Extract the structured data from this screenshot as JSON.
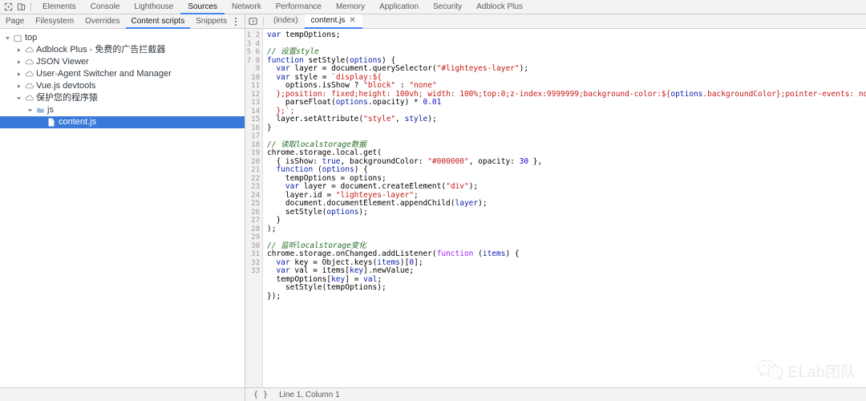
{
  "toolbar": {
    "icons": [
      {
        "name": "inspect-element-icon",
        "label": "Inspect element"
      },
      {
        "name": "device-toolbar-icon",
        "label": "Toggle device toolbar"
      }
    ],
    "tabs": [
      {
        "id": "elements",
        "label": "Elements",
        "active": false
      },
      {
        "id": "console",
        "label": "Console",
        "active": false
      },
      {
        "id": "lighthouse",
        "label": "Lighthouse",
        "active": false
      },
      {
        "id": "sources",
        "label": "Sources",
        "active": true
      },
      {
        "id": "network",
        "label": "Network",
        "active": false
      },
      {
        "id": "performance",
        "label": "Performance",
        "active": false
      },
      {
        "id": "memory",
        "label": "Memory",
        "active": false
      },
      {
        "id": "application",
        "label": "Application",
        "active": false
      },
      {
        "id": "security",
        "label": "Security",
        "active": false
      },
      {
        "id": "adblock",
        "label": "Adblock Plus",
        "active": false
      }
    ],
    "active_accent": "#4285f4"
  },
  "navigator": {
    "tabs": [
      {
        "id": "page",
        "label": "Page",
        "active": false
      },
      {
        "id": "filesystem",
        "label": "Filesystem",
        "active": false
      },
      {
        "id": "overrides",
        "label": "Overrides",
        "active": false
      },
      {
        "id": "content-scripts",
        "label": "Content scripts",
        "active": true
      },
      {
        "id": "snippets",
        "label": "Snippets",
        "active": false
      }
    ],
    "more_label": "More options",
    "tree": [
      {
        "label": "top",
        "indent": 0,
        "icon": "frame-icon",
        "twisty": "open",
        "selected": false
      },
      {
        "label": "Adblock Plus - 免费的广告拦截器",
        "indent": 1,
        "icon": "cloud-icon",
        "twisty": "closed",
        "selected": false
      },
      {
        "label": "JSON Viewer",
        "indent": 1,
        "icon": "cloud-icon",
        "twisty": "closed",
        "selected": false
      },
      {
        "label": "User-Agent Switcher and Manager",
        "indent": 1,
        "icon": "cloud-icon",
        "twisty": "closed",
        "selected": false
      },
      {
        "label": "Vue.js devtools",
        "indent": 1,
        "icon": "cloud-icon",
        "twisty": "closed",
        "selected": false
      },
      {
        "label": "保护您的程序猿",
        "indent": 1,
        "icon": "cloud-icon",
        "twisty": "open",
        "selected": false
      },
      {
        "label": "js",
        "indent": 2,
        "icon": "folder-icon",
        "twisty": "open",
        "selected": false
      },
      {
        "label": "content.js",
        "indent": 3,
        "icon": "file-icon",
        "twisty": "none",
        "selected": true
      }
    ]
  },
  "editor": {
    "nav_toggle_label": "Show navigator",
    "tabs": [
      {
        "id": "index",
        "label": "(index)",
        "active": false,
        "closable": false
      },
      {
        "id": "contentjs",
        "label": "content.js",
        "active": true,
        "closable": true
      }
    ],
    "close_glyph": "✕",
    "total_lines": 33,
    "code_lines": [
      [
        {
          "t": "kw",
          "s": "var"
        },
        {
          "t": "plain",
          "s": " tempOptions;"
        }
      ],
      [],
      [
        {
          "t": "com",
          "s": "// 设置style"
        }
      ],
      [
        {
          "t": "kw",
          "s": "function"
        },
        {
          "t": "plain",
          "s": " setStyle("
        },
        {
          "t": "prop",
          "s": "options"
        },
        {
          "t": "plain",
          "s": ") {"
        }
      ],
      [
        {
          "t": "plain",
          "s": "  "
        },
        {
          "t": "kw",
          "s": "var"
        },
        {
          "t": "plain",
          "s": " layer = document.querySelector("
        },
        {
          "t": "str",
          "s": "\"#lighteyes-layer\""
        },
        {
          "t": "plain",
          "s": ");"
        }
      ],
      [
        {
          "t": "plain",
          "s": "  "
        },
        {
          "t": "kw",
          "s": "var"
        },
        {
          "t": "plain",
          "s": " style = "
        },
        {
          "t": "str",
          "s": "`display:${"
        }
      ],
      [
        {
          "t": "plain",
          "s": "    options.isShow ? "
        },
        {
          "t": "str",
          "s": "\"block\""
        },
        {
          "t": "plain",
          "s": " : "
        },
        {
          "t": "str",
          "s": "\"none\""
        }
      ],
      [
        {
          "t": "plain",
          "s": "  "
        },
        {
          "t": "str",
          "s": "};position: fixed;height: 100vh; width: 100%;top:0;z-index:9999999;background-color:${"
        },
        {
          "t": "prop",
          "s": "options"
        },
        {
          "t": "str",
          "s": ".backgroundColor};pointer-events: none;opacity: ${"
        }
      ],
      [
        {
          "t": "plain",
          "s": "    parseFloat("
        },
        {
          "t": "prop",
          "s": "options"
        },
        {
          "t": "plain",
          "s": ".opacity) * "
        },
        {
          "t": "num",
          "s": "0.01"
        }
      ],
      [
        {
          "t": "plain",
          "s": "  "
        },
        {
          "t": "str",
          "s": "};`;"
        }
      ],
      [
        {
          "t": "plain",
          "s": "  layer.setAttribute("
        },
        {
          "t": "str",
          "s": "\"style\""
        },
        {
          "t": "plain",
          "s": ", "
        },
        {
          "t": "prop",
          "s": "style"
        },
        {
          "t": "plain",
          "s": ");"
        }
      ],
      [
        {
          "t": "plain",
          "s": "}"
        }
      ],
      [],
      [
        {
          "t": "com",
          "s": "// 读取localstorage数据"
        }
      ],
      [
        {
          "t": "plain",
          "s": "chrome.storage.local.get("
        }
      ],
      [
        {
          "t": "plain",
          "s": "  { isShow: "
        },
        {
          "t": "kw",
          "s": "true"
        },
        {
          "t": "plain",
          "s": ", backgroundColor: "
        },
        {
          "t": "str",
          "s": "\"#000000\""
        },
        {
          "t": "plain",
          "s": ", opacity: "
        },
        {
          "t": "num",
          "s": "30"
        },
        {
          "t": "plain",
          "s": " },"
        }
      ],
      [
        {
          "t": "plain",
          "s": "  "
        },
        {
          "t": "kw",
          "s": "function"
        },
        {
          "t": "plain",
          "s": " ("
        },
        {
          "t": "prop",
          "s": "options"
        },
        {
          "t": "plain",
          "s": ") {"
        }
      ],
      [
        {
          "t": "plain",
          "s": "    tempOptions = options;"
        }
      ],
      [
        {
          "t": "plain",
          "s": "    "
        },
        {
          "t": "kw",
          "s": "var"
        },
        {
          "t": "plain",
          "s": " layer = document.createElement("
        },
        {
          "t": "str",
          "s": "\"div\""
        },
        {
          "t": "plain",
          "s": ");"
        }
      ],
      [
        {
          "t": "plain",
          "s": "    layer.id = "
        },
        {
          "t": "str",
          "s": "\"lighteyes-layer\""
        },
        {
          "t": "plain",
          "s": ";"
        }
      ],
      [
        {
          "t": "plain",
          "s": "    document.documentElement.appendChild("
        },
        {
          "t": "prop",
          "s": "layer"
        },
        {
          "t": "plain",
          "s": ");"
        }
      ],
      [
        {
          "t": "plain",
          "s": "    setStyle("
        },
        {
          "t": "prop",
          "s": "options"
        },
        {
          "t": "plain",
          "s": ");"
        }
      ],
      [
        {
          "t": "plain",
          "s": "  }"
        }
      ],
      [
        {
          "t": "plain",
          "s": ");"
        }
      ],
      [],
      [
        {
          "t": "com",
          "s": "// 监听localstorage变化"
        }
      ],
      [
        {
          "t": "plain",
          "s": "chrome.storage.onChanged.addListener("
        },
        {
          "t": "kw2",
          "s": "function"
        },
        {
          "t": "plain",
          "s": " ("
        },
        {
          "t": "prop",
          "s": "items"
        },
        {
          "t": "plain",
          "s": ") {"
        }
      ],
      [
        {
          "t": "plain",
          "s": "  "
        },
        {
          "t": "kw",
          "s": "var"
        },
        {
          "t": "plain",
          "s": " key = Object.keys("
        },
        {
          "t": "prop",
          "s": "items"
        },
        {
          "t": "plain",
          "s": ")["
        },
        {
          "t": "num",
          "s": "0"
        },
        {
          "t": "plain",
          "s": "];"
        }
      ],
      [
        {
          "t": "plain",
          "s": "  "
        },
        {
          "t": "kw",
          "s": "var"
        },
        {
          "t": "plain",
          "s": " val = items["
        },
        {
          "t": "prop",
          "s": "key"
        },
        {
          "t": "plain",
          "s": "].newValue;"
        }
      ],
      [
        {
          "t": "plain",
          "s": "  tempOptions["
        },
        {
          "t": "prop",
          "s": "key"
        },
        {
          "t": "plain",
          "s": "] = "
        },
        {
          "t": "prop",
          "s": "val"
        },
        {
          "t": "plain",
          "s": ";"
        }
      ],
      [
        {
          "t": "plain",
          "s": "    setStyle(tempOptions);"
        }
      ],
      [
        {
          "t": "plain",
          "s": "});"
        }
      ],
      []
    ]
  },
  "status_bar": {
    "pretty_print_glyph": "{ }",
    "pretty_print_label": "Pretty print",
    "cursor_text": "Line 1, Column 1"
  },
  "watermark": {
    "icon": "wechat-icon",
    "text": "ELab团队"
  }
}
